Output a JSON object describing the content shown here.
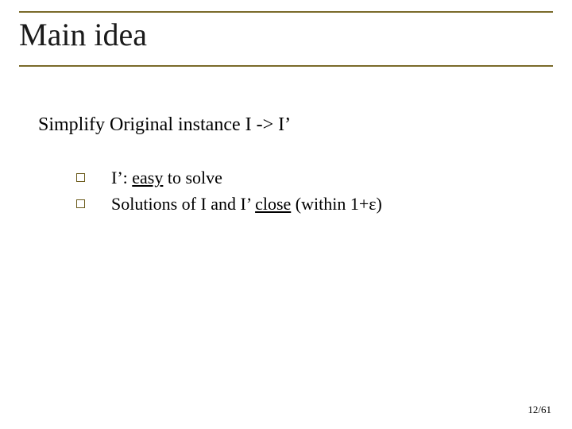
{
  "title": "Main idea",
  "subtitle": "Simplify Original instance I -> I’",
  "bullets": [
    {
      "prefix": "I’: ",
      "underlined": "easy",
      "suffix": " to solve"
    },
    {
      "prefix": "Solutions of I and I’ ",
      "underlined": "close",
      "suffix": " (within 1+ε)"
    }
  ],
  "pagenum": "12/61"
}
